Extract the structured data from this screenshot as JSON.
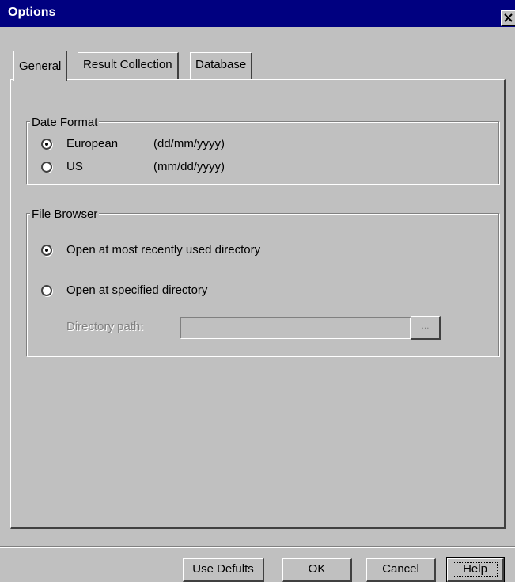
{
  "window": {
    "title": "Options"
  },
  "tabs": [
    {
      "label": "General",
      "active": true
    },
    {
      "label": "Result Collection",
      "active": false
    },
    {
      "label": "Database",
      "active": false
    }
  ],
  "date_format": {
    "title": "Date Format",
    "options": [
      {
        "label": "European",
        "format": "(dd/mm/yyyy)",
        "selected": true
      },
      {
        "label": "US",
        "format": "(mm/dd/yyyy)",
        "selected": false
      }
    ]
  },
  "file_browser": {
    "title": "File Browser",
    "options": [
      {
        "label": "Open at most recently used directory",
        "selected": true
      },
      {
        "label": "Open at specified directory",
        "selected": false
      }
    ],
    "directory_path_label": "Directory path:",
    "directory_path_value": "",
    "browse_label": "..."
  },
  "buttons": {
    "use_defaults": "Use Defults",
    "ok": "OK",
    "cancel": "Cancel",
    "help": "Help"
  }
}
